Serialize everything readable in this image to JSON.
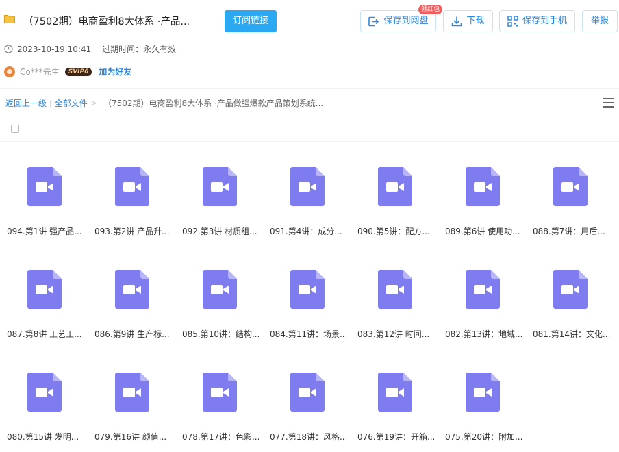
{
  "share": {
    "title": "（7502期）电商盈利8大体系 ·产品...",
    "subscribe_label": "订阅链接",
    "date": "2023-10-19 10:41",
    "expiry": "过期时间：永久有效"
  },
  "actions": {
    "save_netdisk": "保存到网盘",
    "red_packet_badge": "领红包",
    "download": "下载",
    "save_phone": "保存到手机",
    "report": "举报"
  },
  "user": {
    "name": "Co***先生",
    "vip": "SVIP6",
    "add_friend": "加为好友"
  },
  "breadcrumb": {
    "back": "返回上一级",
    "all_files": "全部文件",
    "sep": ">",
    "current": "（7502期）电商盈利8大体系 ·产品做强爆款产品策划系统..."
  },
  "colors": {
    "accent": "#2aa8f2",
    "link": "#2a88e0",
    "file_icon": "#7f7cf0",
    "file_icon_fold": "#b8b6f7"
  },
  "files": [
    {
      "name": "094.第1讲 强产品..."
    },
    {
      "name": "093.第2讲 产品升..."
    },
    {
      "name": "092.第3讲 材质组..."
    },
    {
      "name": "091.第4讲：成分..."
    },
    {
      "name": "090.第5讲：配方..."
    },
    {
      "name": "089.第6讲 使用功..."
    },
    {
      "name": "088.第7讲：用后..."
    },
    {
      "name": "087.第8讲 工艺工..."
    },
    {
      "name": "086.第9讲 生产标..."
    },
    {
      "name": "085.第10讲：结构..."
    },
    {
      "name": "084.第11讲：场景..."
    },
    {
      "name": "083.第12讲 时间..."
    },
    {
      "name": "082.第13讲：地域..."
    },
    {
      "name": "081.第14讲：文化..."
    },
    {
      "name": "080.第15讲 发明..."
    },
    {
      "name": "079.第16讲 颜值..."
    },
    {
      "name": "078.第17讲：色彩..."
    },
    {
      "name": "077.第18讲：风格..."
    },
    {
      "name": "076.第19讲：开箱..."
    },
    {
      "name": "075.第20讲：附加..."
    }
  ]
}
